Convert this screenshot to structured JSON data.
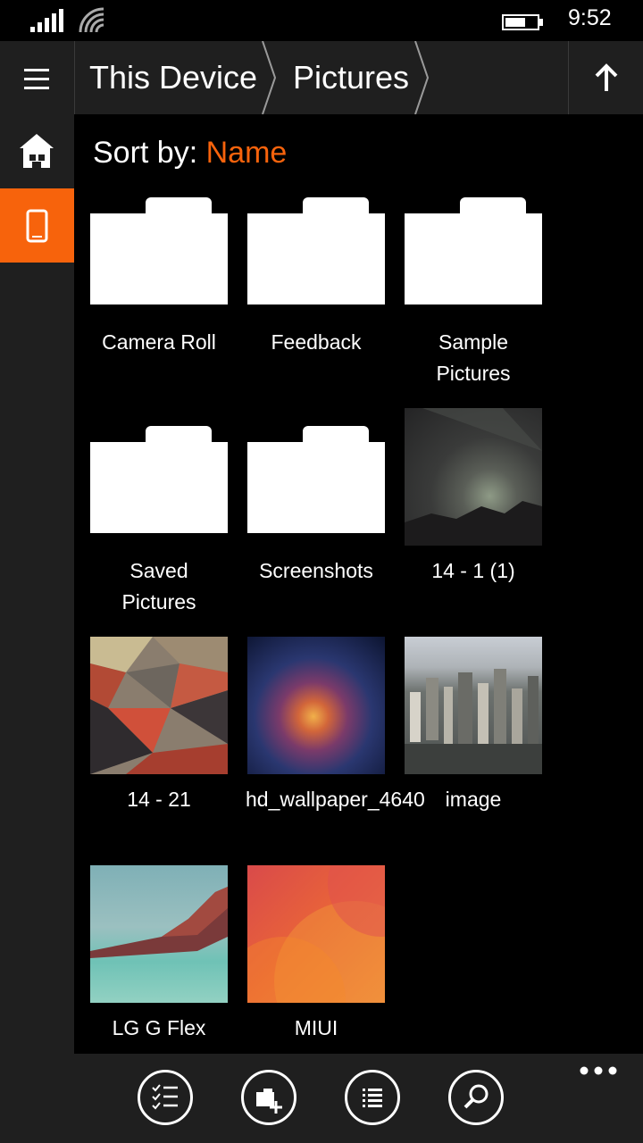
{
  "status_bar": {
    "time": "9:52",
    "signal_icon": "signal-bars-icon",
    "wifi_icon": "wifi-icon",
    "battery_icon": "battery-icon"
  },
  "header": {
    "breadcrumbs": [
      "This Device",
      "Pictures"
    ],
    "menu_icon": "hamburger-menu-icon",
    "up_icon": "up-arrow-icon"
  },
  "sidebar": {
    "items": [
      {
        "icon": "home-icon",
        "active": false
      },
      {
        "icon": "phone-device-icon",
        "active": true
      }
    ]
  },
  "sort": {
    "label": "Sort by: ",
    "value": "Name"
  },
  "items": [
    {
      "name": "Camera Roll",
      "type": "folder"
    },
    {
      "name": "Feedback",
      "type": "folder"
    },
    {
      "name": "Sample Pictures",
      "type": "folder"
    },
    {
      "name": "Saved Pictures",
      "type": "folder"
    },
    {
      "name": "Screenshots",
      "type": "folder"
    },
    {
      "name": "14 - 1 (1)",
      "type": "image"
    },
    {
      "name": "14 - 21",
      "type": "image"
    },
    {
      "name": "hd_wallpaper_4640",
      "type": "image"
    },
    {
      "name": "image",
      "type": "image"
    },
    {
      "name": "LG G Flex",
      "type": "image"
    },
    {
      "name": "MIUI",
      "type": "image"
    }
  ],
  "bottom_bar": {
    "buttons": [
      "select-checklist-icon",
      "new-folder-icon",
      "list-view-icon",
      "search-icon"
    ],
    "more_icon": "more-dots-icon"
  },
  "colors": {
    "accent": "#f7630c",
    "bar": "#1f1f1f",
    "background": "#000000"
  }
}
